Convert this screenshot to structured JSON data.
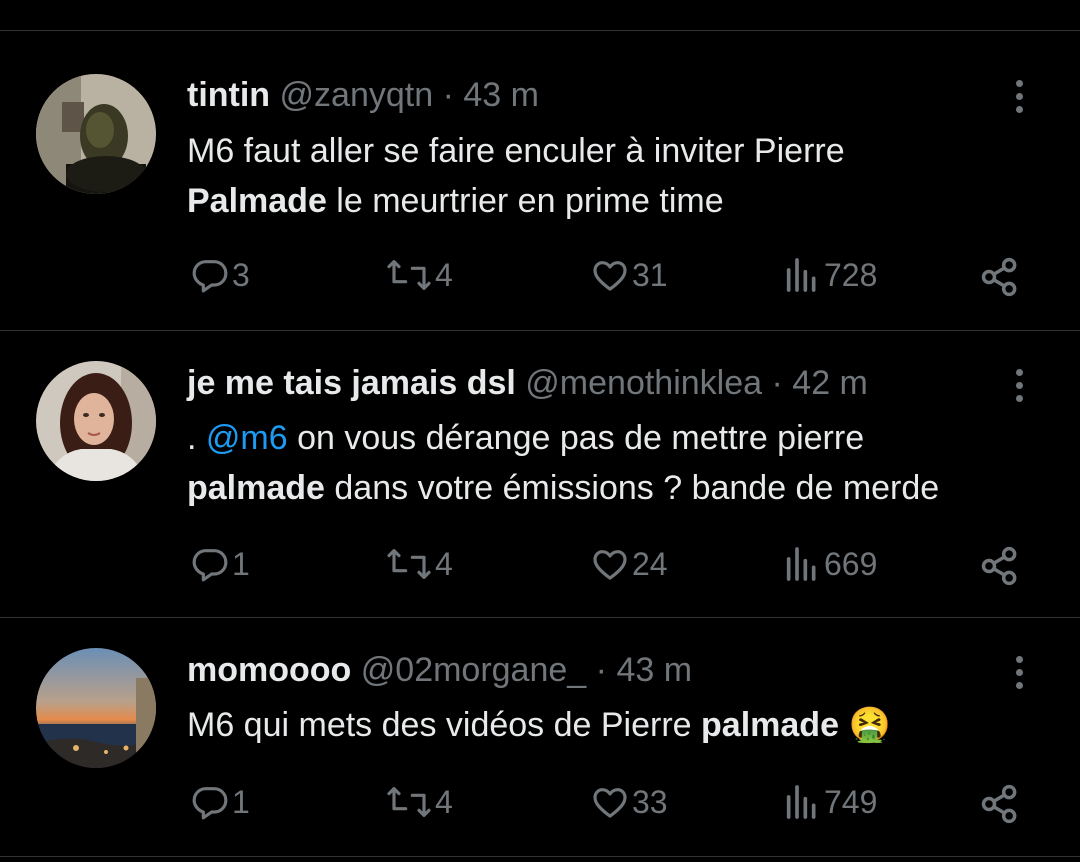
{
  "tweets": [
    {
      "name": "tintin",
      "handle": "@zanyqtn",
      "separator": "·",
      "time": "43 m",
      "text": {
        "part1": "M6 faut aller se faire enculer à inviter Pierre",
        "bold": "Palmade",
        "part2": " le meurtrier en prime time"
      },
      "replies": "3",
      "retweets": "4",
      "likes": "31",
      "views": "728"
    },
    {
      "name": "je me tais jamais dsl",
      "handle": "@menothinklea",
      "separator": "·",
      "time": "42 m",
      "text": {
        "prefix": ". ",
        "mention": "@m6",
        "part1": " on vous dérange pas de mettre pierre",
        "bold": "palmade",
        "part2": " dans votre émissions ? bande de merde"
      },
      "replies": "1",
      "retweets": "4",
      "likes": "24",
      "views": "669"
    },
    {
      "name": "momoooo",
      "handle": "@02morgane_",
      "separator": "·",
      "time": "43 m",
      "text": {
        "part1": "M6 qui mets des vidéos de Pierre ",
        "bold": "palmade",
        "emoji": "🤮"
      },
      "replies": "1",
      "retweets": "4",
      "likes": "33",
      "views": "749"
    }
  ],
  "icons": {
    "reply": "reply-icon",
    "retweet": "retweet-icon",
    "like": "heart-icon",
    "views": "views-icon",
    "share": "share-icon",
    "more": "more-icon"
  }
}
